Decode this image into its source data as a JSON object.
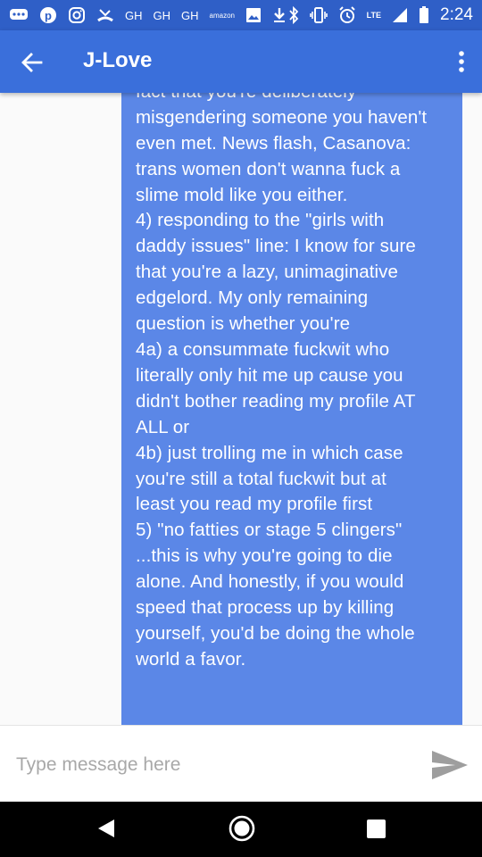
{
  "status_bar": {
    "time": "2:24",
    "network": "LTE",
    "left_icons": [
      "chat-bubble-icon",
      "pinterest-icon",
      "instagram-icon",
      "missed-call-icon",
      "gh-icon",
      "gh-icon",
      "gh-icon",
      "amazon-icon",
      "image-icon",
      "download-icon"
    ],
    "right_icons": [
      "bluetooth-icon",
      "vibrate-icon",
      "alarm-icon",
      "signal-icon",
      "battery-icon"
    ],
    "gh_label": "GH",
    "amazon_label": "amazon"
  },
  "header": {
    "title": "J-Love"
  },
  "message": {
    "text": "fuck someone with a dick. It's the\nfact that you're deliberately\nmisgendering someone you haven't\neven met. News flash, Casanova:\ntrans women don't wanna fuck a\nslime mold like you either.\n4) responding to the \"girls with\ndaddy issues\" line: I know for sure\nthat you're a lazy, unimaginative\nedgelord. My only remaining\nquestion is whether you're\n4a) a consummate fuckwit who\nliterally only hit me up cause you\ndidn't bother reading my profile AT\nALL or\n4b) just trolling me in which case\nyou're still a total fuckwit but at\nleast you read my profile first\n5) \"no fatties or stage 5 clingers\"\n...this is why you're going to die\nalone. And honestly, if you would\nspeed that process up by killing\nyourself, you'd be doing the whole\nworld a favor."
  },
  "compose": {
    "placeholder": "Type message here",
    "value": ""
  },
  "colors": {
    "status_bar": "#2f5fc7",
    "app_bar": "#3a6fdb",
    "bubble": "#5b87e7",
    "send_icon": "#9e9e9e"
  }
}
